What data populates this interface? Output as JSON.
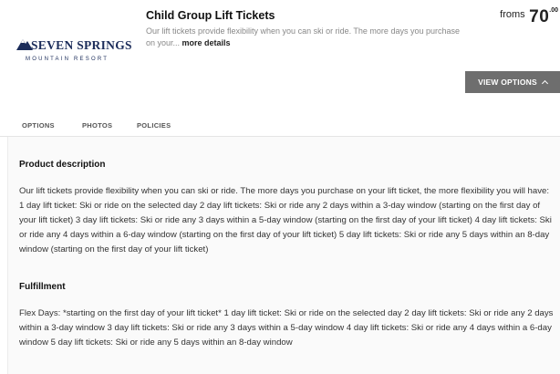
{
  "logo": {
    "brand": "SEVEN SPRINGS",
    "subtitle": "MOUNTAIN RESORT",
    "color": "#1b2c5a"
  },
  "product": {
    "title": "Child Group Lift Tickets",
    "short_description": "Our lift tickets provide flexibility when you can ski or ride. The more days you purchase on your...",
    "more_link": "more details"
  },
  "price": {
    "prefix": "froms",
    "amount": "70",
    "cents": ".00"
  },
  "view_options": {
    "label": "VIEW OPTIONS",
    "color": "#6e6e6e"
  },
  "tabs": [
    {
      "label": "OPTIONS"
    },
    {
      "label": "PHOTOS"
    },
    {
      "label": "POLICIES"
    }
  ],
  "sections": {
    "product_description": {
      "heading": "Product description",
      "body": "Our lift tickets provide flexibility when you can ski or ride. The more days you purchase on your lift ticket, the more flexibility you will have: 1 day lift ticket: Ski or ride on the selected day 2 day lift tickets: Ski or ride any 2 days within a 3-day window (starting on the first day of your lift ticket) 3 day lift tickets: Ski or ride any 3 days within a 5-day window (starting on the first day of your lift ticket) 4 day lift tickets: Ski or ride any 4 days within a 6-day window (starting on the first day of your lift ticket) 5 day lift tickets: Ski or ride any 5 days within an 8-day window (starting on the first day of your lift ticket)"
    },
    "fulfillment": {
      "heading": "Fulfillment",
      "body": "Flex Days: *starting on the first day of your lift ticket* 1 day lift ticket: Ski or ride on the selected day 2 day lift tickets: Ski or ride any 2 days within a 3-day window 3 day lift tickets: Ski or ride any 3 days within a 5-day window 4 day lift tickets: Ski or ride any 4 days within a 6-day window 5 day lift tickets: Ski or ride any 5 days within an 8-day window"
    }
  }
}
